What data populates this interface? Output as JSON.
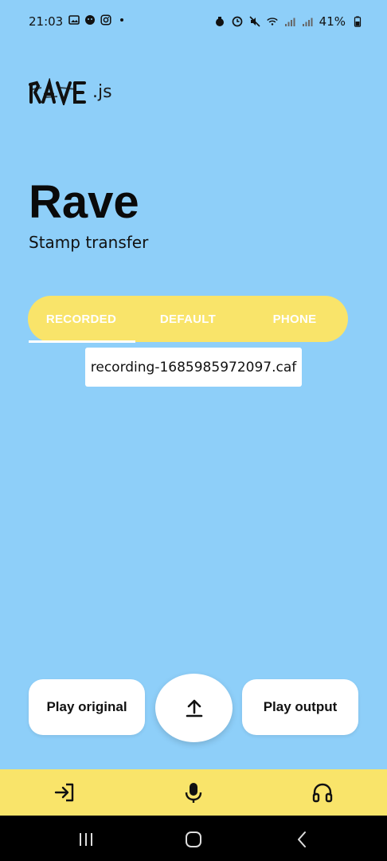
{
  "status_bar": {
    "time": "21:03",
    "battery": "41%",
    "left_icons": [
      "image-icon",
      "face-icon",
      "instagram-icon",
      "dot-icon"
    ],
    "right_icons": [
      "alarm-icon",
      "clock-icon",
      "mute-icon",
      "wifi-icon",
      "signal-icon",
      "signal-icon",
      "battery-icon"
    ]
  },
  "app": {
    "logo_mark": "RAVE",
    "logo_suffix": ".js",
    "title": "Rave",
    "subtitle": "Stamp transfer"
  },
  "tabs": {
    "items": [
      {
        "label": "RECORDED",
        "selected": true
      },
      {
        "label": "DEFAULT",
        "selected": false
      },
      {
        "label": "PHONE",
        "selected": false
      }
    ]
  },
  "file": {
    "name": "recording-1685985972097.caf"
  },
  "actions": {
    "play_original": "Play original",
    "play_output": "Play output",
    "upload_icon": "upload-icon"
  },
  "bottom_nav": {
    "items": [
      "login-icon",
      "mic-icon",
      "headset-icon"
    ]
  },
  "colors": {
    "background": "#8ecff9",
    "accent_yellow": "#f9e46a",
    "white": "#ffffff"
  }
}
